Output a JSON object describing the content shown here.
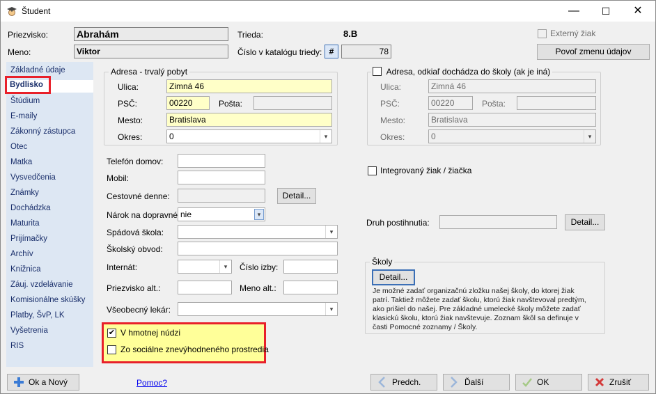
{
  "window": {
    "title": "Študent",
    "minimize": "—",
    "maximize": "☐",
    "close": "✕",
    "app_icon": "student-icon"
  },
  "header": {
    "surname_label": "Priezvisko:",
    "surname_value": "Abrahám",
    "name_label": "Meno:",
    "name_value": "Viktor",
    "class_label": "Trieda:",
    "class_value": "8.B",
    "catalog_label": "Číslo v katalógu triedy:",
    "catalog_hash": "#",
    "catalog_value": "78",
    "external_label": "Externý žiak",
    "allow_change_button": "Povoľ zmenu údajov"
  },
  "sidebar": {
    "items": [
      "Základné údaje",
      "Bydlisko",
      "Štúdium",
      "E-maily",
      "Zákonný zástupca",
      "Otec",
      "Matka",
      "Vysvedčenia",
      "Známky",
      "Dochádzka",
      "Maturita",
      "Prijímačky",
      "Archív",
      "Knižnica",
      "Záuj. vzdelávanie",
      "Komisionálne skúšky",
      "Platby, ŠvP, LK",
      "Vyšetrenia",
      "RIS"
    ],
    "active_index": 1
  },
  "permanent_address": {
    "title": "Adresa - trvalý pobyt",
    "street_label": "Ulica:",
    "street_value": "Zimná 46",
    "zip_label": "PSČ:",
    "zip_value": "00220",
    "post_label": "Pošta:",
    "post_value": "",
    "city_label": "Mesto:",
    "city_value": "Bratislava",
    "district_label": "Okres:",
    "district_value": "0"
  },
  "other_address": {
    "title": "Adresa, odkiaľ dochádza do školy (ak je iná)",
    "street_label": "Ulica:",
    "street_value": "Zimná 46",
    "zip_label": "PSČ:",
    "zip_value": "00220",
    "post_label": "Pošta:",
    "post_value": "",
    "city_label": "Mesto:",
    "city_value": "Bratislava",
    "district_label": "Okres:",
    "district_value": "0"
  },
  "contact": {
    "home_phone_label": "Telefón domov:",
    "home_phone_value": "",
    "mobile_label": "Mobil:",
    "mobile_value": "",
    "commute_label": "Cestovné denne:",
    "commute_value": "",
    "detail_button": "Detail...",
    "transport_claim_label": "Nárok na dopravné:",
    "transport_claim_value": "nie",
    "catchment_school_label": "Spádová škola:",
    "catchment_school_value": "",
    "school_district_label": "Školský obvod:",
    "school_district_value": "",
    "dormitory_label": "Internát:",
    "dormitory_value": "",
    "room_number_label": "Číslo izby:",
    "room_number_value": "",
    "surname_alt_label": "Priezvisko alt.:",
    "surname_alt_value": "",
    "name_alt_label": "Meno alt.:",
    "name_alt_value": "",
    "doctor_label": "Všeobecný lekár:",
    "doctor_value": ""
  },
  "needs": {
    "material_need_label": "V hmotnej núdzi",
    "material_need_checked": "✔",
    "disadvantaged_label": "Zo sociálne znevýhodneného prostredia"
  },
  "integration": {
    "integrated_label": "Integrovaný žiak / žiačka",
    "disability_label": "Druh postihnutia:",
    "disability_value": "",
    "detail_button": "Detail..."
  },
  "schools": {
    "title": "Školy",
    "detail_button": "Detail...",
    "note": [
      "Je možné zadať organizačnú zložku našej školy, do ktorej žiak",
      "patrí. Taktiež môžete zadať školu, ktorú žiak navštevoval predtým,",
      "ako prišiel do našej. Pre základné umelecké školy môžete zadať",
      "klasickú školu, ktorú žiak navštevuje. Zoznam škôl sa definuje v",
      "časti Pomocné zoznamy / Školy."
    ]
  },
  "footer": {
    "ok_new_icon": "plus-icon",
    "ok_new_label": "Ok a Nový",
    "help_link": "Pomoc?",
    "prev_icon": "chevron-left-icon",
    "prev_label": "Predch.",
    "next_icon": "chevron-right-icon",
    "next_label": "Ďalší",
    "ok_icon": "checkmark-icon",
    "ok_label": "OK",
    "cancel_icon": "cross-icon",
    "cancel_label": "Zrušiť"
  },
  "colors": {
    "sidebar_bg": "#dde7f3",
    "highlight_red": "#e8202a",
    "note_box_yellow": "#ffff99",
    "required_field_yellow": "#ffffc8",
    "link_blue": "#0000ee"
  }
}
